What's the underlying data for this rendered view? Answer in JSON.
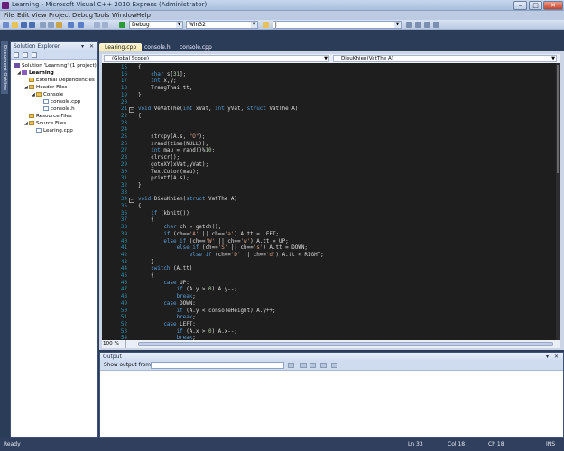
{
  "window": {
    "title": "Learning - Microsoft Visual C++ 2010 Express (Administrator)",
    "min_label": "–",
    "max_label": "□",
    "close_label": "✕"
  },
  "menu": [
    "File",
    "Edit",
    "View",
    "Project",
    "Debug",
    "Tools",
    "Window",
    "Help"
  ],
  "toolbar": {
    "config": "Debug",
    "platform": "Win32",
    "find_value": "j"
  },
  "side_tab": "Document Outline",
  "solution_explorer": {
    "title": "Solution Explorer",
    "controls": "▾ ✕",
    "nodes": [
      {
        "label": "Solution 'Learning' (1 project)"
      },
      {
        "label": "Learning"
      },
      {
        "label": "External Dependencies"
      },
      {
        "label": "Header Files"
      },
      {
        "label": "Console"
      },
      {
        "label": "console.cpp"
      },
      {
        "label": "console.h"
      },
      {
        "label": "Resource Files"
      },
      {
        "label": "Source Files"
      },
      {
        "label": "Learing.cpp"
      }
    ]
  },
  "tabs": [
    "Learing.cpp",
    "console.h",
    "console.cpp"
  ],
  "nav": {
    "scope": "(Global Scope)",
    "member": "DieuKhien(VatThe A)"
  },
  "code_lines": [
    {
      "n": "15",
      "t": "{"
    },
    {
      "n": "16",
      "t": "    char s[31];"
    },
    {
      "n": "17",
      "t": "    int x,y;"
    },
    {
      "n": "18",
      "t": "    TrangThai tt;"
    },
    {
      "n": "19",
      "t": "};"
    },
    {
      "n": "20",
      "t": ""
    },
    {
      "n": "21",
      "t": "void VeVatThe(int xVat, int yVat, struct VatThe A)"
    },
    {
      "n": "22",
      "t": "{"
    },
    {
      "n": "23",
      "t": ""
    },
    {
      "n": "24",
      "t": ""
    },
    {
      "n": "25",
      "t": "    strcpy(A.s, \"O\");"
    },
    {
      "n": "26",
      "t": "    srand(time(NULL));"
    },
    {
      "n": "27",
      "t": "    int mau = rand()%10;"
    },
    {
      "n": "28",
      "t": "    clrscr();"
    },
    {
      "n": "29",
      "t": "    gotoXY(xVat,yVat);"
    },
    {
      "n": "30",
      "t": "    TextColor(mau);"
    },
    {
      "n": "31",
      "t": "    printf(A.s);"
    },
    {
      "n": "32",
      "t": "}"
    },
    {
      "n": "33",
      "t": ""
    },
    {
      "n": "34",
      "t": "void DieuKhien(struct VatThe A)"
    },
    {
      "n": "35",
      "t": "{"
    },
    {
      "n": "36",
      "t": "    if (kbhit())"
    },
    {
      "n": "37",
      "t": "    {"
    },
    {
      "n": "38",
      "t": "        char ch = getch();"
    },
    {
      "n": "39",
      "t": "        if (ch=='A' || ch=='a') A.tt = LEFT;"
    },
    {
      "n": "40",
      "t": "        else if (ch=='W' || ch=='w') A.tt = UP;"
    },
    {
      "n": "41",
      "t": "            else if (ch=='S' || ch=='s') A.tt = DOWN;"
    },
    {
      "n": "42",
      "t": "                else if (ch=='D' || ch=='d') A.tt = RIGHT;"
    },
    {
      "n": "43",
      "t": "    }"
    },
    {
      "n": "44",
      "t": "    switch (A.tt)"
    },
    {
      "n": "45",
      "t": "    {"
    },
    {
      "n": "46",
      "t": "        case UP:"
    },
    {
      "n": "47",
      "t": "            if (A.y > 0) A.y--;"
    },
    {
      "n": "48",
      "t": "            break;"
    },
    {
      "n": "49",
      "t": "        case DOWN:"
    },
    {
      "n": "50",
      "t": "            if (A.y < consoleHeight) A.y++;"
    },
    {
      "n": "51",
      "t": "            break;"
    },
    {
      "n": "52",
      "t": "        case LEFT:"
    },
    {
      "n": "53",
      "t": "            if (A.x > 0) A.x--;"
    },
    {
      "n": "54",
      "t": "            break;"
    }
  ],
  "zoom": "100 %",
  "output": {
    "title": "Output",
    "controls": "▾ ✕",
    "show_label": "Show output from:"
  },
  "status": {
    "ready": "Ready",
    "line": "Ln 33",
    "col": "Col 18",
    "ch": "Ch 18",
    "mode": "INS"
  }
}
